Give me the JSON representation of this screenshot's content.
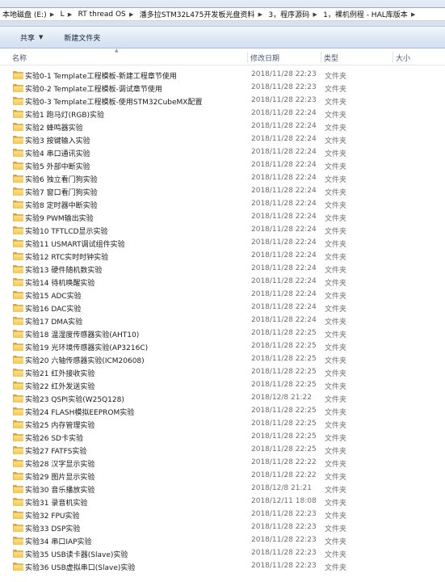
{
  "address": {
    "crumbs": [
      "本地磁盘 (E:)",
      "L",
      "RT thread OS",
      "潘多拉STM32L475开发板光盘资料",
      "3，程序源码",
      "1，裸机例程 - HAL库版本"
    ]
  },
  "toolbar": {
    "share_label": "共享",
    "new_folder_label": "新建文件夹"
  },
  "columns": {
    "name": "名称",
    "date": "修改日期",
    "type": "类型",
    "size": "大小"
  },
  "colors": {
    "folder": "#f2c658",
    "header_text": "#4a5a70"
  },
  "files": [
    {
      "name": "实验0-1 Template工程模板-新建工程章节使用",
      "date": "2018/11/28 22:23",
      "type": "文件夹"
    },
    {
      "name": "实验0-2 Template工程模板-调试章节使用",
      "date": "2018/11/28 22:23",
      "type": "文件夹"
    },
    {
      "name": "实验0-3 Template工程模板-使用STM32CubeMX配置",
      "date": "2018/11/28 22:23",
      "type": "文件夹"
    },
    {
      "name": "实验1 跑马灯(RGB)实验",
      "date": "2018/11/28 22:24",
      "type": "文件夹"
    },
    {
      "name": "实验2 蜂鸣器实验",
      "date": "2018/11/28 22:24",
      "type": "文件夹"
    },
    {
      "name": "实验3 按键输入实验",
      "date": "2018/11/28 22:24",
      "type": "文件夹"
    },
    {
      "name": "实验4 串口通讯实验",
      "date": "2018/11/28 22:24",
      "type": "文件夹"
    },
    {
      "name": "实验5 外部中断实验",
      "date": "2018/11/28 22:24",
      "type": "文件夹"
    },
    {
      "name": "实验6 独立看门狗实验",
      "date": "2018/11/28 22:24",
      "type": "文件夹"
    },
    {
      "name": "实验7 窗口看门狗实验",
      "date": "2018/11/28 22:24",
      "type": "文件夹"
    },
    {
      "name": "实验8 定时器中断实验",
      "date": "2018/11/28 22:24",
      "type": "文件夹"
    },
    {
      "name": "实验9 PWM输出实验",
      "date": "2018/11/28 22:24",
      "type": "文件夹"
    },
    {
      "name": "实验10 TFTLCD显示实验",
      "date": "2018/11/28 22:24",
      "type": "文件夹"
    },
    {
      "name": "实验11 USMART调试组件实验",
      "date": "2018/11/28 22:24",
      "type": "文件夹"
    },
    {
      "name": "实验12 RTC实时时钟实验",
      "date": "2018/11/28 22:24",
      "type": "文件夹"
    },
    {
      "name": "实验13 硬件随机数实验",
      "date": "2018/11/28 22:24",
      "type": "文件夹"
    },
    {
      "name": "实验14 待机唤醒实验",
      "date": "2018/11/28 22:24",
      "type": "文件夹"
    },
    {
      "name": "实验15 ADC实验",
      "date": "2018/11/28 22:24",
      "type": "文件夹"
    },
    {
      "name": "实验16 DAC实验",
      "date": "2018/11/28 22:24",
      "type": "文件夹"
    },
    {
      "name": "实验17 DMA实验",
      "date": "2018/11/28 22:24",
      "type": "文件夹"
    },
    {
      "name": "实验18 温湿度传感器实验(AHT10)",
      "date": "2018/11/28 22:25",
      "type": "文件夹"
    },
    {
      "name": "实验19 光环境传感器实验(AP3216C)",
      "date": "2018/11/28 22:25",
      "type": "文件夹"
    },
    {
      "name": "实验20 六轴传感器实验(ICM20608)",
      "date": "2018/11/28 22:25",
      "type": "文件夹"
    },
    {
      "name": "实验21 红外接收实验",
      "date": "2018/11/28 22:25",
      "type": "文件夹"
    },
    {
      "name": "实验22 红外发送实验",
      "date": "2018/11/28 22:25",
      "type": "文件夹"
    },
    {
      "name": "实验23 QSPI实验(W25Q128)",
      "date": "2018/12/8 21:22",
      "type": "文件夹"
    },
    {
      "name": "实验24 FLASH模拟EEPROM实验",
      "date": "2018/11/28 22:25",
      "type": "文件夹"
    },
    {
      "name": "实验25 内存管理实验",
      "date": "2018/11/28 22:25",
      "type": "文件夹"
    },
    {
      "name": "实验26 SD卡实验",
      "date": "2018/11/28 22:25",
      "type": "文件夹"
    },
    {
      "name": "实验27 FATFS实验",
      "date": "2018/11/28 22:25",
      "type": "文件夹"
    },
    {
      "name": "实验28 汉字显示实验",
      "date": "2018/11/28 22:22",
      "type": "文件夹"
    },
    {
      "name": "实验29 图片显示实验",
      "date": "2018/11/28 22:22",
      "type": "文件夹"
    },
    {
      "name": "实验30 音乐播放实验",
      "date": "2018/12/8 21:21",
      "type": "文件夹"
    },
    {
      "name": "实验31 录音机实验",
      "date": "2018/12/11 18:08",
      "type": "文件夹"
    },
    {
      "name": "实验32 FPU实验",
      "date": "2018/11/28 22:23",
      "type": "文件夹"
    },
    {
      "name": "实验33 DSP实验",
      "date": "2018/11/28 22:23",
      "type": "文件夹"
    },
    {
      "name": "实验34 串口IAP实验",
      "date": "2018/11/28 22:23",
      "type": "文件夹"
    },
    {
      "name": "实验35 USB读卡器(Slave)实验",
      "date": "2018/11/28 22:23",
      "type": "文件夹"
    },
    {
      "name": "实验36 USB虚拟串口(Slave)实验",
      "date": "2018/11/28 22:23",
      "type": "文件夹"
    }
  ]
}
